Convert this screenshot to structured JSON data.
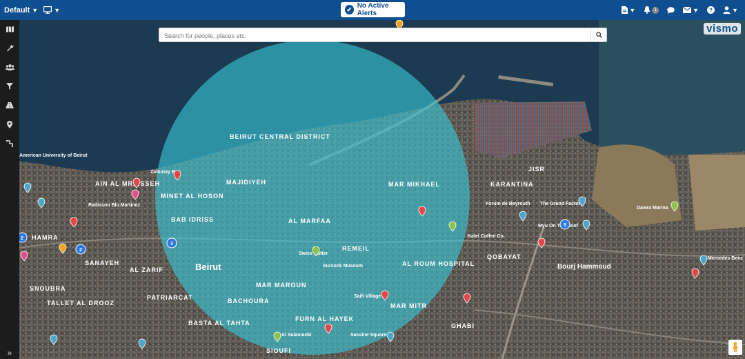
{
  "topbar": {
    "workspace_label": "Default",
    "alert_label": "No Active Alerts",
    "notification_count": "1",
    "colors": {
      "bar": "#0f4f8f"
    }
  },
  "sidebar": {
    "items": [
      {
        "icon": "map-icon"
      },
      {
        "icon": "wrench-icon"
      },
      {
        "icon": "people-icon"
      },
      {
        "icon": "filter-icon"
      },
      {
        "icon": "road-icon"
      },
      {
        "icon": "location-pin-icon"
      },
      {
        "icon": "route-icon"
      }
    ],
    "expand_icon": "double-chevron-right-icon"
  },
  "search": {
    "placeholder": "Search for people, places etc."
  },
  "logo": {
    "text": "vismo"
  },
  "map": {
    "geofence_color": "#38c7d6",
    "labels": [
      "American University of Beirut",
      "AIN AL MREISSEH",
      "Radisson Blu Martinez",
      "MINET AL HOSON",
      "BAB IDRISS",
      "HAMRA",
      "SANAYEH",
      "AL ZARIF",
      "SNOUBRA",
      "TALLET AL DROOZ",
      "BEIRUT CENTRAL DISTRICT",
      "MAJIDIYEH",
      "AL MARFAA",
      "MAR MIKHAEL",
      "REMEIL",
      "AL ROUM HOSPITAL",
      "MAR MAROUN",
      "BACHOURA",
      "PATRIARCAT",
      "BASTA AL TAHTA",
      "FURN AL HAYEK",
      "MAR MITR",
      "Sursock Museum",
      "Swiss Butter",
      "Saifi Village",
      "JISR",
      "KARANTINA",
      "Forum de Beyrouth",
      "The Grand Factory",
      "QOBAYAT",
      "Bourj Hammoud",
      "Dawra Marina",
      "Beirut",
      "Zaitunay Bay",
      "Kalei Coffee Co.",
      "Myu On The Roof",
      "Mercedes Benz",
      "GHABI",
      "Sassine Square",
      "Al Salamanki",
      "SIOUFI"
    ],
    "clusters": [
      {
        "count": "2"
      },
      {
        "count": "2"
      },
      {
        "count": "3"
      },
      {
        "count": "5"
      }
    ]
  }
}
